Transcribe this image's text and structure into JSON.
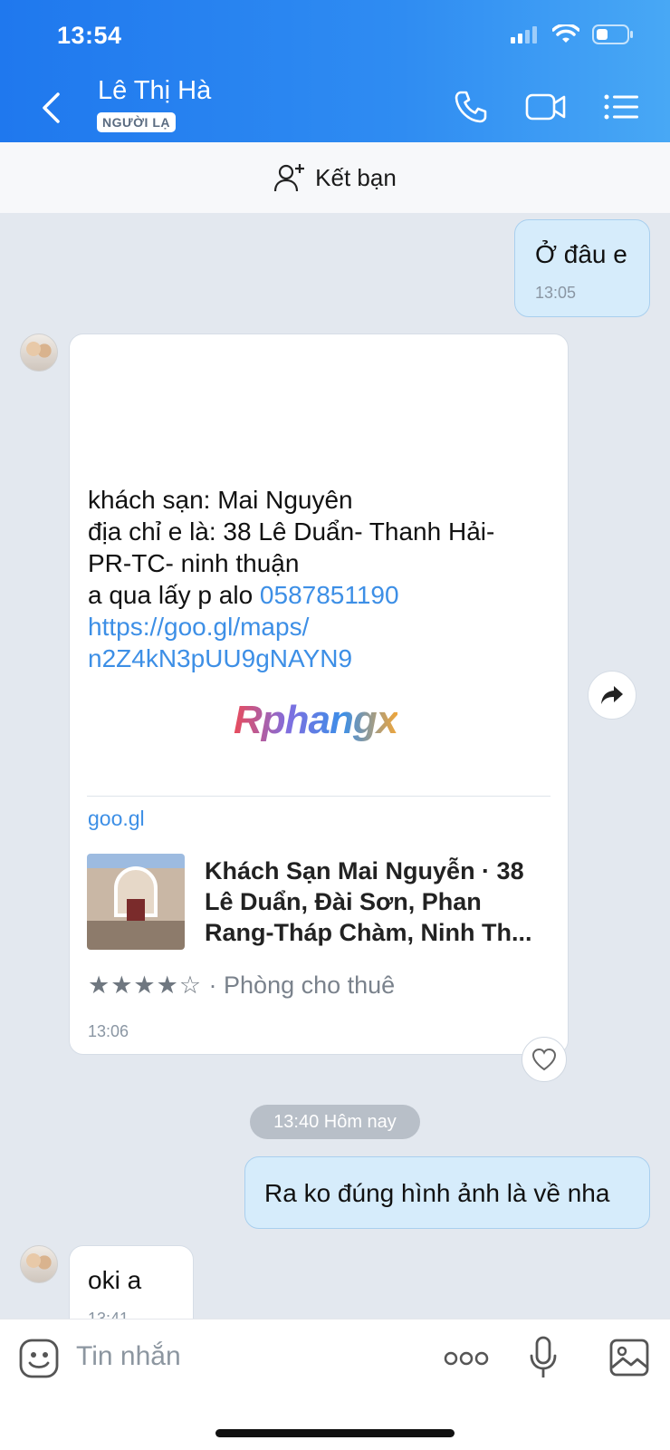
{
  "status_bar": {
    "time": "13:54"
  },
  "header": {
    "name": "Lê Thị Hà",
    "badge": "NGƯỜI LẠ"
  },
  "friend_bar": {
    "label": "Kết bạn"
  },
  "messages": {
    "m1": {
      "text": "Ở đâu e",
      "time": "13:05"
    },
    "m2": {
      "line1": "khách sạn: Mai Nguyên",
      "line2": "địa chỉ e là: 38 Lê Duẩn- Thanh Hải-",
      "line3": "PR-TC- ninh thuận",
      "line4_prefix": "a qua lấy p alo ",
      "phone": "0587851190",
      "url_line1": "https://goo.gl/maps/",
      "url_line2": "n2Z4kN3pUU9gNAYN9",
      "watermark": "Rphangx",
      "preview_domain": "goo.gl",
      "preview_title_1": "Khách Sạn Mai Nguyễn · 38",
      "preview_title_2": "Lê Duẩn, Đài Sơn, Phan",
      "preview_title_3": "Rang-Tháp Chàm, Ninh Th...",
      "preview_stars": "★★★★☆",
      "preview_rating": 4,
      "preview_category": " · Phòng cho thuê",
      "time": "13:06"
    },
    "day_divider": "13:40 Hôm nay",
    "m3": {
      "text": "Ra ko đúng hình ảnh là về nha"
    },
    "m4": {
      "text": "oki a",
      "time": "13:41"
    }
  },
  "composer": {
    "placeholder": "Tin nhắn"
  },
  "colors": {
    "header_blue": "#2f8cf2",
    "link_blue": "#3d8fe6",
    "my_bubble": "#d6ecfb"
  }
}
